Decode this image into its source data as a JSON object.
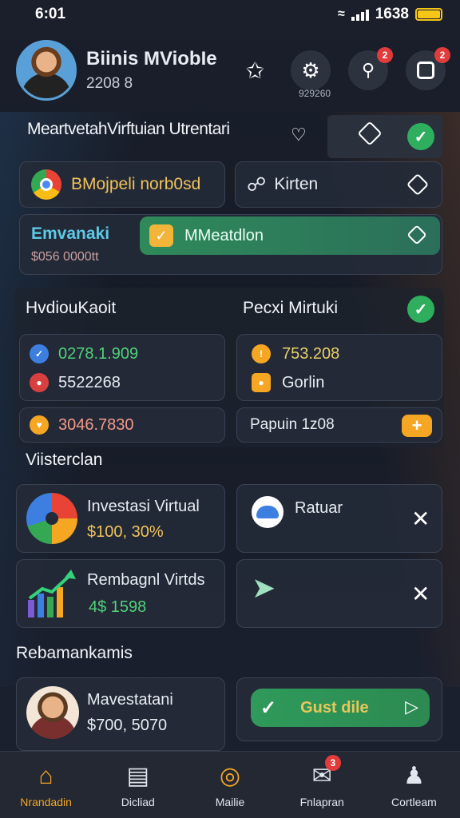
{
  "status": {
    "time": "6:01",
    "clock": "1638"
  },
  "profile": {
    "name": "Biinis MViobIe",
    "id": "2208 8",
    "gear_caption": "929260"
  },
  "header_badges": {
    "search": "2",
    "device": "2"
  },
  "feature_row": {
    "title": "MeartvetahVirftuian Utrentari"
  },
  "chip_browser": {
    "label": "BMojpeli norb0sd"
  },
  "chip_kirten": {
    "label": "Kirten"
  },
  "promo": {
    "title": "Emvanaki",
    "subtitle": "$056 0000tt",
    "pill_label": "MMeatdlon"
  },
  "stats_left": {
    "title": "HvdiouKaoit",
    "value1": "0278.1.909",
    "value2": "5522268",
    "value3": "3046.7830"
  },
  "stats_right": {
    "title": "Pecxi Mirtuki",
    "value1": "753.208",
    "value2": "Gorlin",
    "action_label": "Papuin 1z08",
    "action_icon": "+"
  },
  "section_visterclan": {
    "label": "Viisterclan"
  },
  "card_investasi": {
    "title": "Investasi Virtual",
    "value": "$100, 30%"
  },
  "card_ratuar": {
    "title": "Ratuar"
  },
  "card_rembagnl": {
    "title": "Rembagnl Virtds",
    "value": "4$ 1598"
  },
  "section_rebamankamis": {
    "label": "Rebamankamis"
  },
  "card_mavestatani": {
    "title": "Mavestatani",
    "value": "$700, 5070"
  },
  "gust_button": {
    "label": "Gust dile"
  },
  "nav": [
    {
      "label": "Nrandadin",
      "icon": "home-icon",
      "active": true
    },
    {
      "label": "Dicliad",
      "icon": "chart-icon",
      "active": false
    },
    {
      "label": "Mailie",
      "icon": "target-icon",
      "active": false
    },
    {
      "label": "Fnlapran",
      "icon": "mail-icon",
      "active": false,
      "badge": "3"
    },
    {
      "label": "Cortleam",
      "icon": "person-icon",
      "active": false
    }
  ],
  "colors": {
    "accent": "#f5a623",
    "green": "#2fae5d",
    "panel": "#242a37"
  }
}
